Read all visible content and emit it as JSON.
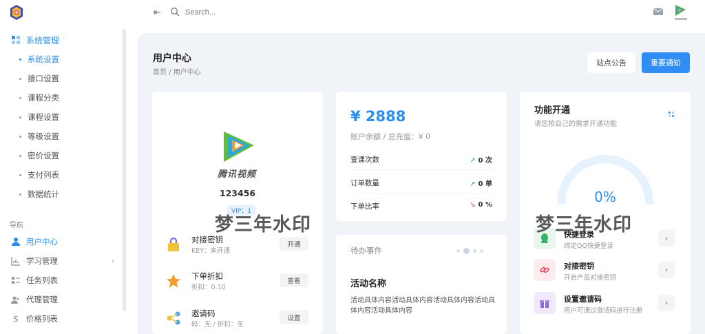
{
  "topbar": {
    "search_placeholder": "Search..."
  },
  "sidebar": {
    "system_group": {
      "label": "系统管理",
      "items": [
        {
          "label": "系统设置",
          "active": true
        },
        {
          "label": "接口设置"
        },
        {
          "label": "课程分类"
        },
        {
          "label": "课程设置"
        },
        {
          "label": "等级设置"
        },
        {
          "label": "密价设置"
        },
        {
          "label": "支付列表"
        },
        {
          "label": "数据统计"
        }
      ]
    },
    "section_label": "导航",
    "nav_items": [
      {
        "label": "用户中心",
        "icon": "user-icon",
        "active": true
      },
      {
        "label": "学习管理",
        "icon": "chart-icon",
        "has_children": true
      },
      {
        "label": "任务列表",
        "icon": "list-icon"
      },
      {
        "label": "代理管理",
        "icon": "agents-icon"
      },
      {
        "label": "价格列表",
        "icon": "dollar-icon"
      }
    ]
  },
  "page": {
    "title": "用户中心",
    "breadcrumb": "首页 / 用户中心",
    "btn_notice": "站点公告",
    "btn_important": "重要通知"
  },
  "profile": {
    "logo_text": "腾讯视频",
    "username": "123456",
    "vip": "VIP：1",
    "features": [
      {
        "title": "对接密钥",
        "sub": "KEY：未开通",
        "button": "开通",
        "icon": "lock-icon"
      },
      {
        "title": "下单折扣",
        "sub": "折扣：0.10",
        "button": "查看",
        "icon": "star-icon"
      },
      {
        "title": "邀请码",
        "sub": "码：无 / 折扣：无",
        "button": "设置",
        "icon": "share-icon"
      }
    ]
  },
  "balance": {
    "amount": "¥ 2888",
    "sub": "账户余额 / 总充值：¥ 0",
    "stats": [
      {
        "label": "查课次数",
        "value": "0 次",
        "arrow": "↗",
        "color": "#2eae6e"
      },
      {
        "label": "订单数量",
        "value": "0 单",
        "arrow": "↗",
        "color": "#2eae6e"
      },
      {
        "label": "下单比率",
        "value": "0 %",
        "arrow": "↘",
        "color": "#e0405a"
      }
    ]
  },
  "todo": {
    "title": "待办事件",
    "activity_name": "活动名称",
    "activity_body": "活动具体内容活动具体内容活动具体内容活动具体内容活动具体内容"
  },
  "func": {
    "title": "功能开通",
    "sub": "请您按自己的需求开通功能",
    "percent": "0%",
    "progress": 0,
    "rows": [
      {
        "title": "快捷登录",
        "sub": "绑定QQ快捷登录",
        "icon": "qq-icon",
        "bg": "#e8f6ee"
      },
      {
        "title": "对接密钥",
        "sub": "开启产品对接密钥",
        "icon": "link-icon",
        "bg": "#fdecef"
      },
      {
        "title": "设置邀请码",
        "sub": "用户可通过邀请码进行注册",
        "icon": "gift-icon",
        "bg": "#efeafb"
      }
    ]
  },
  "watermark": "梦三年水印",
  "colors": {
    "accent": "#2b8ff0",
    "bg": "#f0f3f8"
  }
}
